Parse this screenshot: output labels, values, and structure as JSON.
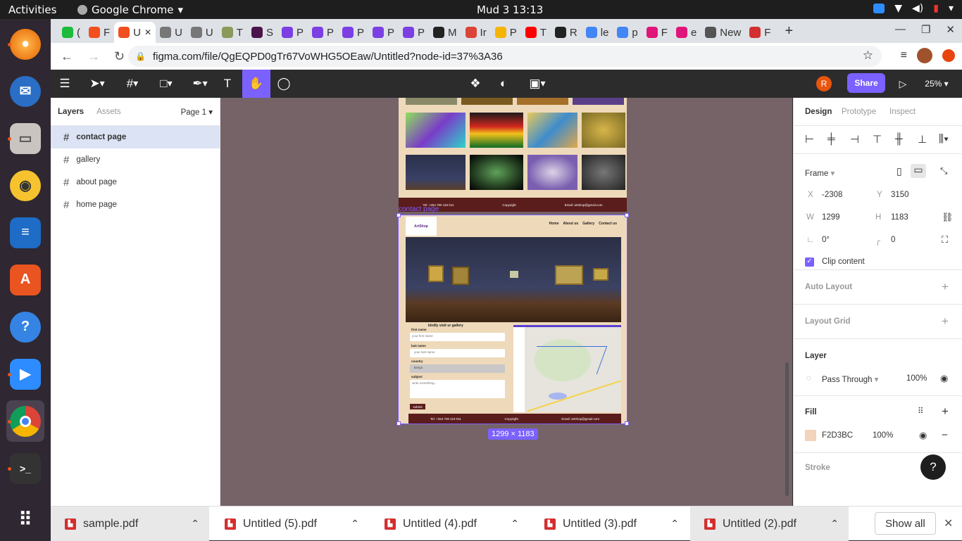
{
  "system": {
    "activities": "Activities",
    "app": "Google Chrome",
    "clock": "Mud 3  13:13"
  },
  "browser": {
    "tabs": [
      "(",
      "F",
      "U",
      "U",
      "U",
      "T",
      "S",
      "P",
      "P",
      "P",
      "P",
      "P",
      "M",
      "Ir",
      "P",
      "T",
      "R",
      "le",
      "p",
      "F",
      "e",
      "New",
      "F"
    ],
    "url": "figma.com/file/QgEQPD0gTr67VoWHG5OEaw/Untitled?node-id=37%3A36"
  },
  "figma": {
    "avatar": "R",
    "share": "Share",
    "zoom": "25%",
    "layers_tab": "Layers",
    "assets_tab": "Assets",
    "page": "Page 1",
    "layers": [
      "contact page",
      "gallery",
      "about page",
      "home page"
    ],
    "design_tabs": [
      "Design",
      "Prototype",
      "Inspect"
    ],
    "frame_label": "Frame",
    "x_label": "X",
    "x": "-2308",
    "y_label": "Y",
    "y": "3150",
    "w_label": "W",
    "w": "1299",
    "h_label": "H",
    "h": "1183",
    "rot": "0°",
    "radius": "0",
    "clip": "Clip content",
    "auto_layout": "Auto Layout",
    "layout_grid": "Layout Grid",
    "layer": "Layer",
    "blend": "Pass Through",
    "opacity": "100%",
    "fill": "Fill",
    "fill_hex": "F2D3BC",
    "fill_opacity": "100%",
    "stroke": "Stroke",
    "help": "?",
    "frame_size": "1299 × 1183",
    "frame_name": "contact page"
  },
  "site": {
    "logo": "ArtShop",
    "nav": [
      "Home",
      "About us",
      "Gallery",
      "Contact us"
    ],
    "caption": "kindly visit ur gallery",
    "first": "first name",
    "first_ph": "your first name",
    "last": "last name",
    "last_ph": "your last name",
    "country": "country",
    "country_val": "kenya",
    "subject": "subject",
    "subject_ph": "write something...",
    "submit": "submit",
    "tel": "Tel: +254 700 119 011",
    "copyright": "Copyright",
    "email": "Email: artshop@gmail.com"
  },
  "downloads": {
    "files": [
      "sample.pdf",
      "Untitled (5).pdf",
      "Untitled (4).pdf",
      "Untitled (3).pdf",
      "Untitled (2).pdf"
    ],
    "show_all": "Show all"
  },
  "colors": {
    "accent": "#7b61ff",
    "canvas": "#756367",
    "frame": "#F2D3BC",
    "footer": "#5b1c1c"
  }
}
